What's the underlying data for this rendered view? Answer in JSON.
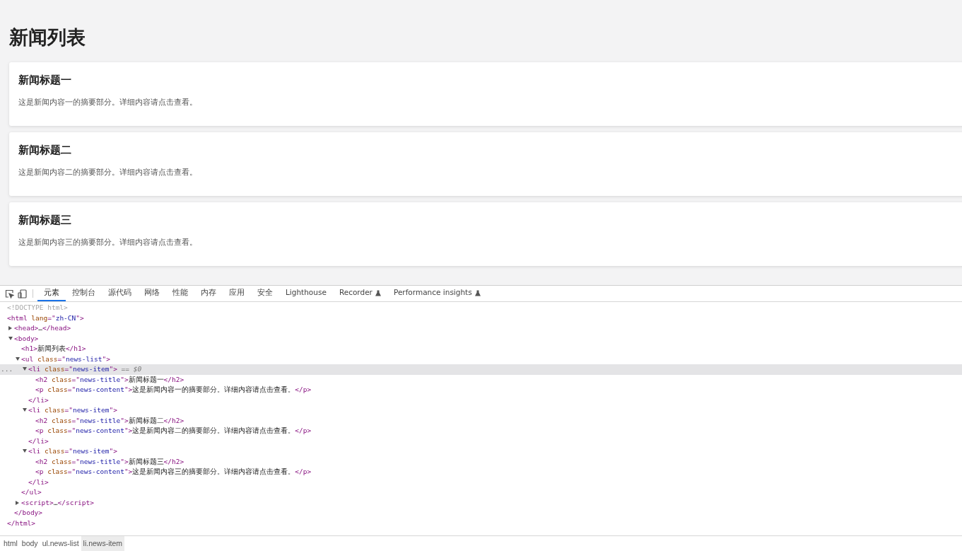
{
  "page": {
    "heading": "新闻列表",
    "news": [
      {
        "title": "新闻标题一",
        "content": "这是新闻内容一的摘要部分。详细内容请点击查看。"
      },
      {
        "title": "新闻标题二",
        "content": "这是新闻内容二的摘要部分。详细内容请点击查看。"
      },
      {
        "title": "新闻标题三",
        "content": "这是新闻内容三的摘要部分。详细内容请点击查看。"
      }
    ]
  },
  "devtools": {
    "tools": [
      {
        "kind": "inspect"
      },
      {
        "kind": "device"
      }
    ],
    "tabs": [
      {
        "label": "元素",
        "selected": true,
        "experimental": false
      },
      {
        "label": "控制台",
        "selected": false,
        "experimental": false
      },
      {
        "label": "源代码",
        "selected": false,
        "experimental": false
      },
      {
        "label": "网络",
        "selected": false,
        "experimental": false
      },
      {
        "label": "性能",
        "selected": false,
        "experimental": false
      },
      {
        "label": "内存",
        "selected": false,
        "experimental": false
      },
      {
        "label": "应用",
        "selected": false,
        "experimental": false
      },
      {
        "label": "安全",
        "selected": false,
        "experimental": false
      },
      {
        "label": "Lighthouse",
        "selected": false,
        "experimental": false
      },
      {
        "label": "Recorder",
        "selected": false,
        "experimental": true
      },
      {
        "label": "Performance insights",
        "selected": false,
        "experimental": true
      }
    ],
    "dom_tree": [
      {
        "line": [
          {
            "kind": "doctype",
            "text": "<!DOCTYPE html>"
          }
        ],
        "selected": false
      },
      {
        "line": [
          {
            "kind": "tag",
            "text": "<html"
          },
          {
            "kind": "attr",
            "text": " lang"
          },
          {
            "kind": "tag",
            "text": "=\""
          },
          {
            "kind": "value",
            "text": "zh-CN"
          },
          {
            "kind": "tag",
            "text": "\">"
          }
        ],
        "selected": false,
        "children": [
          {
            "line": [
              {
                "kind": "tag",
                "text": "<head>"
              },
              {
                "kind": "text",
                "text": "…"
              },
              {
                "kind": "tag",
                "text": "</head>"
              }
            ],
            "expanded": false,
            "selected": false
          },
          {
            "line": [
              {
                "kind": "tag",
                "text": "<body>"
              }
            ],
            "expanded": true,
            "selected": false,
            "children": [
              {
                "line": [
                  {
                    "kind": "tag",
                    "text": "<h1>"
                  },
                  {
                    "kind": "text",
                    "text": "新闻列表"
                  },
                  {
                    "kind": "tag",
                    "text": "</h1>"
                  }
                ],
                "selected": false
              },
              {
                "line": [
                  {
                    "kind": "tag",
                    "text": "<ul"
                  },
                  {
                    "kind": "attr",
                    "text": " class"
                  },
                  {
                    "kind": "tag",
                    "text": "=\""
                  },
                  {
                    "kind": "value",
                    "text": "news-list"
                  },
                  {
                    "kind": "tag",
                    "text": "\">"
                  }
                ],
                "expanded": true,
                "selected": false,
                "children": [
                  {
                    "line": [
                      {
                        "kind": "tag",
                        "text": "<li"
                      },
                      {
                        "kind": "attr",
                        "text": " class"
                      },
                      {
                        "kind": "tag",
                        "text": "=\""
                      },
                      {
                        "kind": "value",
                        "text": "news-item"
                      },
                      {
                        "kind": "tag",
                        "text": "\">"
                      },
                      {
                        "kind": "marker",
                        "text": " == $0"
                      }
                    ],
                    "expanded": true,
                    "selected": true,
                    "more": "...",
                    "children": [
                      {
                        "line": [
                          {
                            "kind": "tag",
                            "text": "<h2"
                          },
                          {
                            "kind": "attr",
                            "text": " class"
                          },
                          {
                            "kind": "tag",
                            "text": "=\""
                          },
                          {
                            "kind": "value",
                            "text": "news-title"
                          },
                          {
                            "kind": "tag",
                            "text": "\">"
                          },
                          {
                            "kind": "text",
                            "text": "新闻标题一"
                          },
                          {
                            "kind": "tag",
                            "text": "</h2>"
                          }
                        ],
                        "selected": false
                      },
                      {
                        "line": [
                          {
                            "kind": "tag",
                            "text": "<p"
                          },
                          {
                            "kind": "attr",
                            "text": " class"
                          },
                          {
                            "kind": "tag",
                            "text": "=\""
                          },
                          {
                            "kind": "value",
                            "text": "news-content"
                          },
                          {
                            "kind": "tag",
                            "text": "\">"
                          },
                          {
                            "kind": "text",
                            "text": "这是新闻内容一的摘要部分。详细内容请点击查看。"
                          },
                          {
                            "kind": "tag",
                            "text": "</p>"
                          }
                        ],
                        "selected": false
                      }
                    ],
                    "end": [
                      {
                        "kind": "tag",
                        "text": "</li>"
                      }
                    ]
                  },
                  {
                    "line": [
                      {
                        "kind": "tag",
                        "text": "<li"
                      },
                      {
                        "kind": "attr",
                        "text": " class"
                      },
                      {
                        "kind": "tag",
                        "text": "=\""
                      },
                      {
                        "kind": "value",
                        "text": "news-item"
                      },
                      {
                        "kind": "tag",
                        "text": "\">"
                      }
                    ],
                    "expanded": true,
                    "selected": false,
                    "children": [
                      {
                        "line": [
                          {
                            "kind": "tag",
                            "text": "<h2"
                          },
                          {
                            "kind": "attr",
                            "text": " class"
                          },
                          {
                            "kind": "tag",
                            "text": "=\""
                          },
                          {
                            "kind": "value",
                            "text": "news-title"
                          },
                          {
                            "kind": "tag",
                            "text": "\">"
                          },
                          {
                            "kind": "text",
                            "text": "新闻标题二"
                          },
                          {
                            "kind": "tag",
                            "text": "</h2>"
                          }
                        ],
                        "selected": false
                      },
                      {
                        "line": [
                          {
                            "kind": "tag",
                            "text": "<p"
                          },
                          {
                            "kind": "attr",
                            "text": " class"
                          },
                          {
                            "kind": "tag",
                            "text": "=\""
                          },
                          {
                            "kind": "value",
                            "text": "news-content"
                          },
                          {
                            "kind": "tag",
                            "text": "\">"
                          },
                          {
                            "kind": "text",
                            "text": "这是新闻内容二的摘要部分。详细内容请点击查看。"
                          },
                          {
                            "kind": "tag",
                            "text": "</p>"
                          }
                        ],
                        "selected": false
                      }
                    ],
                    "end": [
                      {
                        "kind": "tag",
                        "text": "</li>"
                      }
                    ]
                  },
                  {
                    "line": [
                      {
                        "kind": "tag",
                        "text": "<li"
                      },
                      {
                        "kind": "attr",
                        "text": " class"
                      },
                      {
                        "kind": "tag",
                        "text": "=\""
                      },
                      {
                        "kind": "value",
                        "text": "news-item"
                      },
                      {
                        "kind": "tag",
                        "text": "\">"
                      }
                    ],
                    "expanded": true,
                    "selected": false,
                    "children": [
                      {
                        "line": [
                          {
                            "kind": "tag",
                            "text": "<h2"
                          },
                          {
                            "kind": "attr",
                            "text": " class"
                          },
                          {
                            "kind": "tag",
                            "text": "=\""
                          },
                          {
                            "kind": "value",
                            "text": "news-title"
                          },
                          {
                            "kind": "tag",
                            "text": "\">"
                          },
                          {
                            "kind": "text",
                            "text": "新闻标题三"
                          },
                          {
                            "kind": "tag",
                            "text": "</h2>"
                          }
                        ],
                        "selected": false
                      },
                      {
                        "line": [
                          {
                            "kind": "tag",
                            "text": "<p"
                          },
                          {
                            "kind": "attr",
                            "text": " class"
                          },
                          {
                            "kind": "tag",
                            "text": "=\""
                          },
                          {
                            "kind": "value",
                            "text": "news-content"
                          },
                          {
                            "kind": "tag",
                            "text": "\">"
                          },
                          {
                            "kind": "text",
                            "text": "这是新闻内容三的摘要部分。详细内容请点击查看。"
                          },
                          {
                            "kind": "tag",
                            "text": "</p>"
                          }
                        ],
                        "selected": false
                      }
                    ],
                    "end": [
                      {
                        "kind": "tag",
                        "text": "</li>"
                      }
                    ]
                  }
                ],
                "end": [
                  {
                    "kind": "tag",
                    "text": "</ul>"
                  }
                ]
              },
              {
                "line": [
                  {
                    "kind": "tag",
                    "text": "<script>"
                  },
                  {
                    "kind": "text",
                    "text": "…"
                  },
                  {
                    "kind": "tag",
                    "text": "</script>"
                  }
                ],
                "expanded": false,
                "selected": false
              }
            ],
            "end": [
              {
                "kind": "tag",
                "text": "</body>"
              }
            ]
          }
        ],
        "end": [
          {
            "kind": "tag",
            "text": "</html>"
          }
        ]
      }
    ],
    "breadcrumbs": [
      {
        "label": "html",
        "selected": false
      },
      {
        "label": "body",
        "selected": false
      },
      {
        "label": "ul.news-list",
        "selected": false
      },
      {
        "label": "li.news-item",
        "selected": true
      }
    ]
  }
}
